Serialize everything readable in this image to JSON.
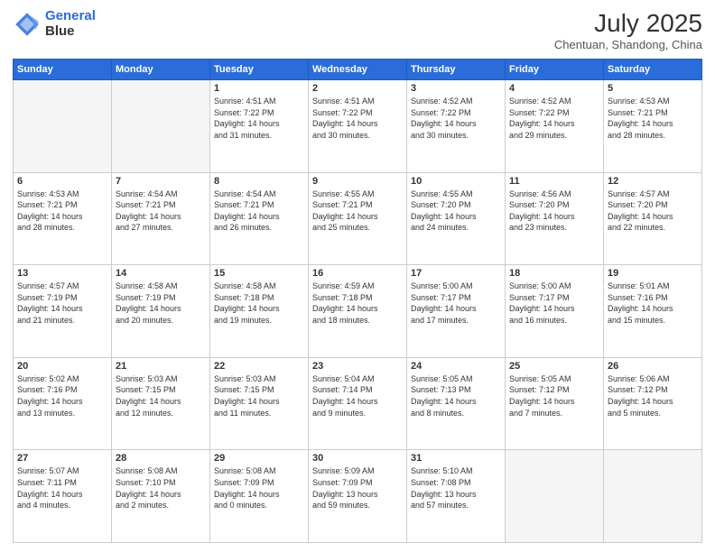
{
  "header": {
    "logo_line1": "General",
    "logo_line2": "Blue",
    "month_year": "July 2025",
    "location": "Chentuan, Shandong, China"
  },
  "days_of_week": [
    "Sunday",
    "Monday",
    "Tuesday",
    "Wednesday",
    "Thursday",
    "Friday",
    "Saturday"
  ],
  "weeks": [
    [
      {
        "day": "",
        "info": ""
      },
      {
        "day": "",
        "info": ""
      },
      {
        "day": "1",
        "info": "Sunrise: 4:51 AM\nSunset: 7:22 PM\nDaylight: 14 hours\nand 31 minutes."
      },
      {
        "day": "2",
        "info": "Sunrise: 4:51 AM\nSunset: 7:22 PM\nDaylight: 14 hours\nand 30 minutes."
      },
      {
        "day": "3",
        "info": "Sunrise: 4:52 AM\nSunset: 7:22 PM\nDaylight: 14 hours\nand 30 minutes."
      },
      {
        "day": "4",
        "info": "Sunrise: 4:52 AM\nSunset: 7:22 PM\nDaylight: 14 hours\nand 29 minutes."
      },
      {
        "day": "5",
        "info": "Sunrise: 4:53 AM\nSunset: 7:21 PM\nDaylight: 14 hours\nand 28 minutes."
      }
    ],
    [
      {
        "day": "6",
        "info": "Sunrise: 4:53 AM\nSunset: 7:21 PM\nDaylight: 14 hours\nand 28 minutes."
      },
      {
        "day": "7",
        "info": "Sunrise: 4:54 AM\nSunset: 7:21 PM\nDaylight: 14 hours\nand 27 minutes."
      },
      {
        "day": "8",
        "info": "Sunrise: 4:54 AM\nSunset: 7:21 PM\nDaylight: 14 hours\nand 26 minutes."
      },
      {
        "day": "9",
        "info": "Sunrise: 4:55 AM\nSunset: 7:21 PM\nDaylight: 14 hours\nand 25 minutes."
      },
      {
        "day": "10",
        "info": "Sunrise: 4:55 AM\nSunset: 7:20 PM\nDaylight: 14 hours\nand 24 minutes."
      },
      {
        "day": "11",
        "info": "Sunrise: 4:56 AM\nSunset: 7:20 PM\nDaylight: 14 hours\nand 23 minutes."
      },
      {
        "day": "12",
        "info": "Sunrise: 4:57 AM\nSunset: 7:20 PM\nDaylight: 14 hours\nand 22 minutes."
      }
    ],
    [
      {
        "day": "13",
        "info": "Sunrise: 4:57 AM\nSunset: 7:19 PM\nDaylight: 14 hours\nand 21 minutes."
      },
      {
        "day": "14",
        "info": "Sunrise: 4:58 AM\nSunset: 7:19 PM\nDaylight: 14 hours\nand 20 minutes."
      },
      {
        "day": "15",
        "info": "Sunrise: 4:58 AM\nSunset: 7:18 PM\nDaylight: 14 hours\nand 19 minutes."
      },
      {
        "day": "16",
        "info": "Sunrise: 4:59 AM\nSunset: 7:18 PM\nDaylight: 14 hours\nand 18 minutes."
      },
      {
        "day": "17",
        "info": "Sunrise: 5:00 AM\nSunset: 7:17 PM\nDaylight: 14 hours\nand 17 minutes."
      },
      {
        "day": "18",
        "info": "Sunrise: 5:00 AM\nSunset: 7:17 PM\nDaylight: 14 hours\nand 16 minutes."
      },
      {
        "day": "19",
        "info": "Sunrise: 5:01 AM\nSunset: 7:16 PM\nDaylight: 14 hours\nand 15 minutes."
      }
    ],
    [
      {
        "day": "20",
        "info": "Sunrise: 5:02 AM\nSunset: 7:16 PM\nDaylight: 14 hours\nand 13 minutes."
      },
      {
        "day": "21",
        "info": "Sunrise: 5:03 AM\nSunset: 7:15 PM\nDaylight: 14 hours\nand 12 minutes."
      },
      {
        "day": "22",
        "info": "Sunrise: 5:03 AM\nSunset: 7:15 PM\nDaylight: 14 hours\nand 11 minutes."
      },
      {
        "day": "23",
        "info": "Sunrise: 5:04 AM\nSunset: 7:14 PM\nDaylight: 14 hours\nand 9 minutes."
      },
      {
        "day": "24",
        "info": "Sunrise: 5:05 AM\nSunset: 7:13 PM\nDaylight: 14 hours\nand 8 minutes."
      },
      {
        "day": "25",
        "info": "Sunrise: 5:05 AM\nSunset: 7:12 PM\nDaylight: 14 hours\nand 7 minutes."
      },
      {
        "day": "26",
        "info": "Sunrise: 5:06 AM\nSunset: 7:12 PM\nDaylight: 14 hours\nand 5 minutes."
      }
    ],
    [
      {
        "day": "27",
        "info": "Sunrise: 5:07 AM\nSunset: 7:11 PM\nDaylight: 14 hours\nand 4 minutes."
      },
      {
        "day": "28",
        "info": "Sunrise: 5:08 AM\nSunset: 7:10 PM\nDaylight: 14 hours\nand 2 minutes."
      },
      {
        "day": "29",
        "info": "Sunrise: 5:08 AM\nSunset: 7:09 PM\nDaylight: 14 hours\nand 0 minutes."
      },
      {
        "day": "30",
        "info": "Sunrise: 5:09 AM\nSunset: 7:09 PM\nDaylight: 13 hours\nand 59 minutes."
      },
      {
        "day": "31",
        "info": "Sunrise: 5:10 AM\nSunset: 7:08 PM\nDaylight: 13 hours\nand 57 minutes."
      },
      {
        "day": "",
        "info": ""
      },
      {
        "day": "",
        "info": ""
      }
    ]
  ]
}
